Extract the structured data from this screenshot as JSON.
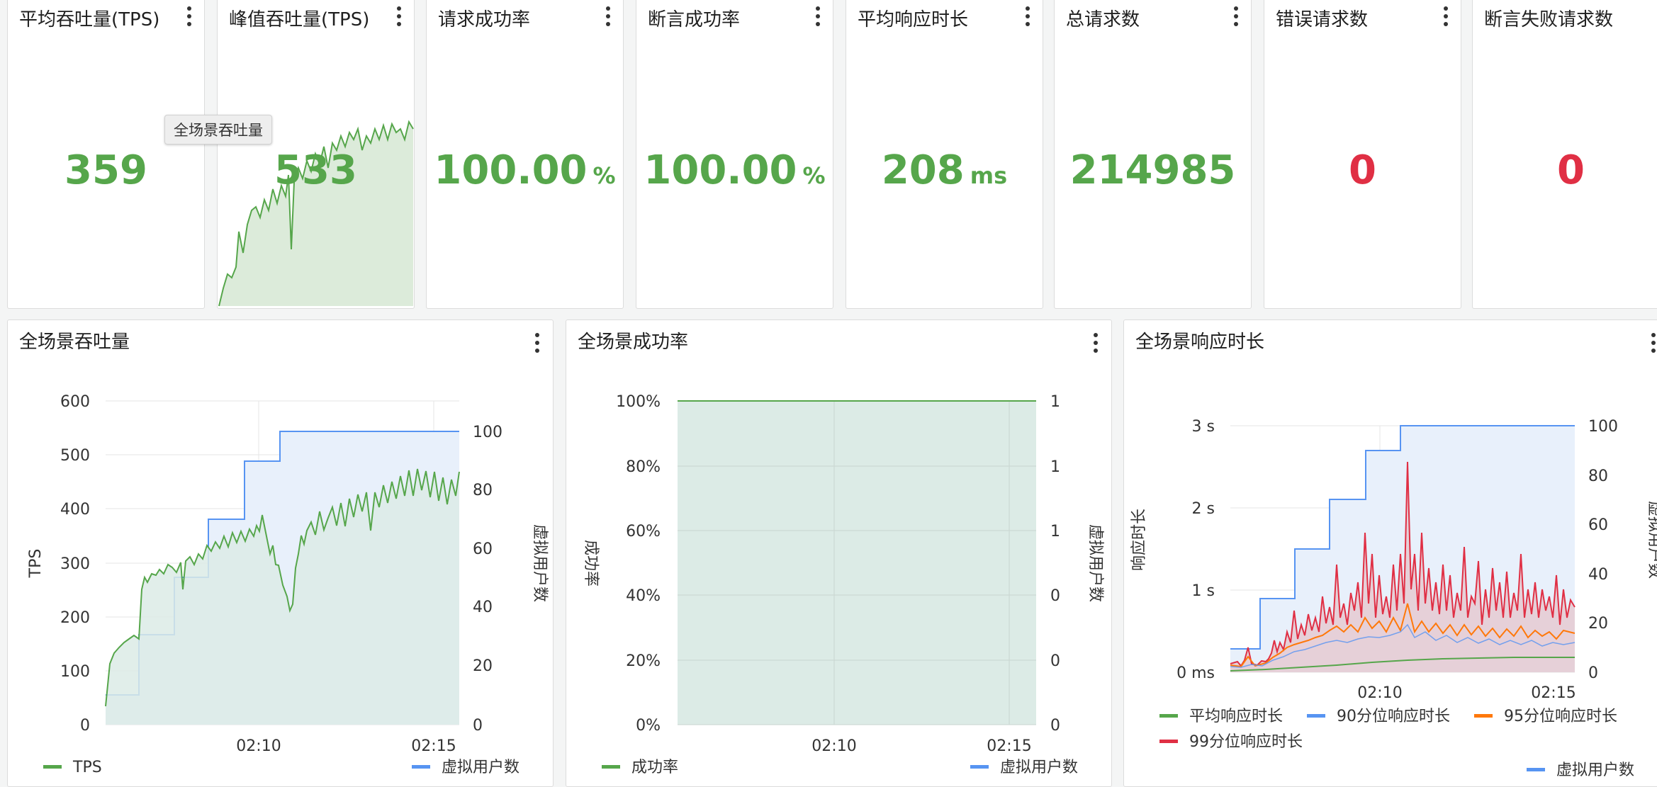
{
  "stats": [
    {
      "title": "平均吞吐量(TPS)",
      "value": "359",
      "unit": "",
      "color": "#56a64b"
    },
    {
      "title": "峰值吞吐量(TPS)",
      "value": "533",
      "unit": "",
      "color": "#56a64b"
    },
    {
      "title": "请求成功率",
      "value": "100.00",
      "unit": "%",
      "color": "#56a64b"
    },
    {
      "title": "断言成功率",
      "value": "100.00",
      "unit": "%",
      "color": "#56a64b"
    },
    {
      "title": "平均响应时长",
      "value": "208",
      "unit": "ms",
      "color": "#56a64b"
    },
    {
      "title": "总请求数",
      "value": "214985",
      "unit": "",
      "color": "#56a64b"
    },
    {
      "title": "错误请求数",
      "value": "0",
      "unit": "",
      "color": "#e02f44"
    },
    {
      "title": "断言失败请求数",
      "value": "0",
      "unit": "",
      "color": "#e02f44"
    }
  ],
  "tooltip": "全场景吞吐量",
  "charts": {
    "throughput": {
      "title": "全场景吞吐量"
    },
    "success": {
      "title": "全场景成功率"
    },
    "response": {
      "title": "全场景响应时长"
    }
  },
  "chart_data": [
    {
      "type": "line",
      "title": "全场景吞吐量",
      "ylabel": "TPS",
      "y2label": "虚拟用户数",
      "ylim": [
        0,
        600
      ],
      "y2lim": [
        0,
        110
      ],
      "yticks": [
        "0",
        "100",
        "200",
        "300",
        "400",
        "500",
        "600"
      ],
      "y2ticks": [
        "0",
        "20",
        "40",
        "60",
        "80",
        "100"
      ],
      "xticks": [
        "02:10",
        "02:15"
      ],
      "series": [
        {
          "name": "TPS",
          "color": "#56a64b",
          "values": [
            55,
            95,
            140,
            155,
            162,
            168,
            250,
            285,
            270,
            290,
            265,
            300,
            310,
            240,
            320,
            300,
            340,
            350,
            330,
            355,
            345,
            360,
            340,
            360,
            300,
            255,
            220,
            260,
            300,
            340,
            370,
            390,
            405,
            400,
            440,
            420,
            460,
            440,
            470,
            480,
            450,
            490,
            470,
            500,
            480,
            510,
            460,
            520,
            490,
            470,
            525,
            500
          ]
        },
        {
          "name": "虚拟用户数",
          "color": "#5794f2",
          "values": [
            10,
            10,
            10,
            10,
            10,
            30,
            30,
            30,
            30,
            30,
            50,
            50,
            50,
            50,
            50,
            70,
            70,
            70,
            70,
            70,
            90,
            90,
            90,
            90,
            90,
            100,
            100,
            100,
            100,
            100,
            100,
            100,
            100,
            100,
            100,
            100,
            100,
            100,
            100,
            100,
            100,
            100,
            100,
            100,
            100,
            100,
            100,
            100,
            100,
            100,
            100,
            100
          ]
        }
      ]
    },
    {
      "type": "area",
      "title": "全场景成功率",
      "ylabel": "成功率",
      "y2label": "虚拟用户数",
      "ylim": [
        0,
        100
      ],
      "yticks": [
        "0%",
        "20%",
        "40%",
        "60%",
        "80%",
        "100%"
      ],
      "y2ticks": [
        "0",
        "0",
        "0",
        "1",
        "1",
        "1"
      ],
      "xticks": [
        "02:10",
        "02:15"
      ],
      "series": [
        {
          "name": "成功率",
          "color": "#56a64b",
          "values": [
            100,
            100,
            100,
            100,
            100,
            100,
            100,
            100,
            100,
            100
          ]
        },
        {
          "name": "虚拟用户数",
          "color": "#5794f2",
          "values": []
        }
      ]
    },
    {
      "type": "line",
      "title": "全场景响应时长",
      "ylabel": "响应时长",
      "y2label": "虚拟用户数",
      "ylim": [
        0,
        3.1
      ],
      "y2lim": [
        0,
        100
      ],
      "yticks": [
        "0 ms",
        "1 s",
        "2 s",
        "3 s"
      ],
      "y2ticks": [
        "0",
        "20",
        "40",
        "60",
        "80",
        "100"
      ],
      "xticks": [
        "02:10",
        "02:15"
      ],
      "series": [
        {
          "name": "平均响应时长",
          "color": "#56a64b",
          "values": [
            0.02,
            0.03,
            0.04,
            0.06,
            0.08,
            0.1,
            0.12,
            0.13,
            0.15,
            0.16,
            0.17,
            0.18,
            0.19,
            0.2,
            0.2,
            0.21,
            0.21,
            0.21,
            0.21,
            0.21,
            0.21
          ]
        },
        {
          "name": "90分位响应时长",
          "color": "#5794f2",
          "values": [
            0.05,
            0.06,
            0.1,
            0.2,
            0.25,
            0.35,
            0.45,
            0.5,
            0.55,
            0.6,
            0.55,
            0.6,
            0.5,
            0.55,
            0.5,
            0.45,
            0.5,
            0.45,
            0.4,
            0.45,
            0.4
          ]
        },
        {
          "name": "95分位响应时长",
          "color": "#ff780a",
          "values": [
            0.06,
            0.08,
            0.15,
            0.3,
            0.35,
            0.45,
            0.55,
            0.65,
            0.75,
            0.8,
            0.7,
            0.75,
            0.65,
            0.7,
            0.65,
            0.6,
            0.65,
            0.55,
            0.5,
            0.55,
            0.5
          ]
        },
        {
          "name": "99分位响应时长",
          "color": "#e02f44",
          "values": [
            0.1,
            0.3,
            0.5,
            0.9,
            1.1,
            1.4,
            1.5,
            1.8,
            2.0,
            2.8,
            1.6,
            1.7,
            1.5,
            1.8,
            1.4,
            1.3,
            1.6,
            1.2,
            1.1,
            1.3,
            1.0
          ]
        },
        {
          "name": "虚拟用户数",
          "color": "#5794f2",
          "values": [
            10,
            10,
            10,
            30,
            30,
            50,
            50,
            70,
            70,
            90,
            100,
            100,
            100,
            100,
            100,
            100,
            100,
            100,
            100,
            100,
            100
          ]
        }
      ]
    }
  ]
}
